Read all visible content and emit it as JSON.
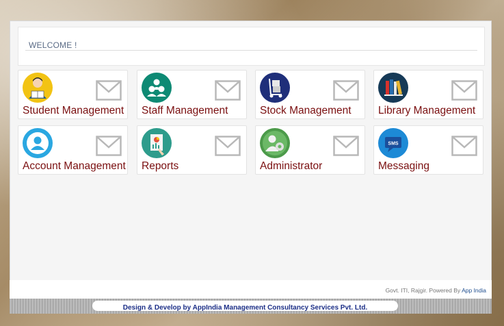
{
  "welcome": {
    "title": "WELCOME !"
  },
  "tiles": [
    {
      "label": "Student Management",
      "icon": "student-icon",
      "color": "#f2c313"
    },
    {
      "label": "Staff Management",
      "icon": "staff-icon",
      "color": "#0e8a74"
    },
    {
      "label": "Stock Management",
      "icon": "stock-icon",
      "color": "#1f2f7a"
    },
    {
      "label": "Library Management",
      "icon": "library-icon",
      "color": "#163a57"
    },
    {
      "label": "Account Management",
      "icon": "account-icon",
      "color": "#2aa7e1"
    },
    {
      "label": "Reports",
      "icon": "reports-icon",
      "color": "#2e9c8c"
    },
    {
      "label": "Administrator",
      "icon": "administrator-icon",
      "color": "#4c9a4a"
    },
    {
      "label": "Messaging",
      "icon": "messaging-icon",
      "color": "#1d8ad6"
    }
  ],
  "footer": {
    "credit_prefix": "Govt. ITI, Rajgir. Powered By",
    "credit_brand": "App India",
    "design_text": "Design & Develop by AppIndia Management Consultancy Services Pvt. Ltd."
  },
  "colors": {
    "tile_label": "#7a0f10",
    "welcome_text": "#5a6b86",
    "footer_text": "#1b2e86"
  }
}
